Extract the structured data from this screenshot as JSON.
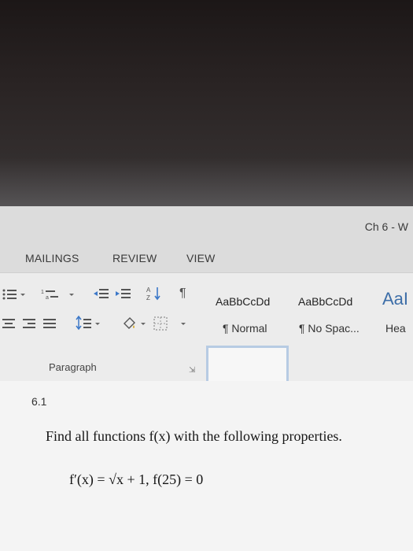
{
  "window": {
    "title": "Ch 6 - W"
  },
  "tabs": [
    {
      "label": "MAILINGS"
    },
    {
      "label": "REVIEW"
    },
    {
      "label": "VIEW"
    }
  ],
  "paragraph_tools": {
    "icons": [
      "bullets-icon",
      "numbering-icon",
      "multilevel-list-icon",
      "decrease-indent-icon",
      "increase-indent-icon",
      "sort-icon",
      "show-formatting-icon",
      "align-center-icon",
      "align-right-icon",
      "justify-icon",
      "line-spacing-icon",
      "shading-icon",
      "borders-icon"
    ],
    "group_label": "Paragraph"
  },
  "styles": [
    {
      "sample": "AaBbCcDd",
      "name": "¶ Normal",
      "selected": true
    },
    {
      "sample": "AaBbCcDd",
      "name": "¶ No Spac..."
    },
    {
      "sample": "AaI",
      "name": "Hea"
    }
  ],
  "document": {
    "section_number": "6.1",
    "question": "Find all functions f(x) with the following properties.",
    "formula": "f′(x) = √x + 1, f(25) = 0"
  },
  "colors": {
    "selected_style_border": "#b7cbe3",
    "ribbon_bg": "#ececec",
    "page_bg": "#f4f4f4"
  }
}
